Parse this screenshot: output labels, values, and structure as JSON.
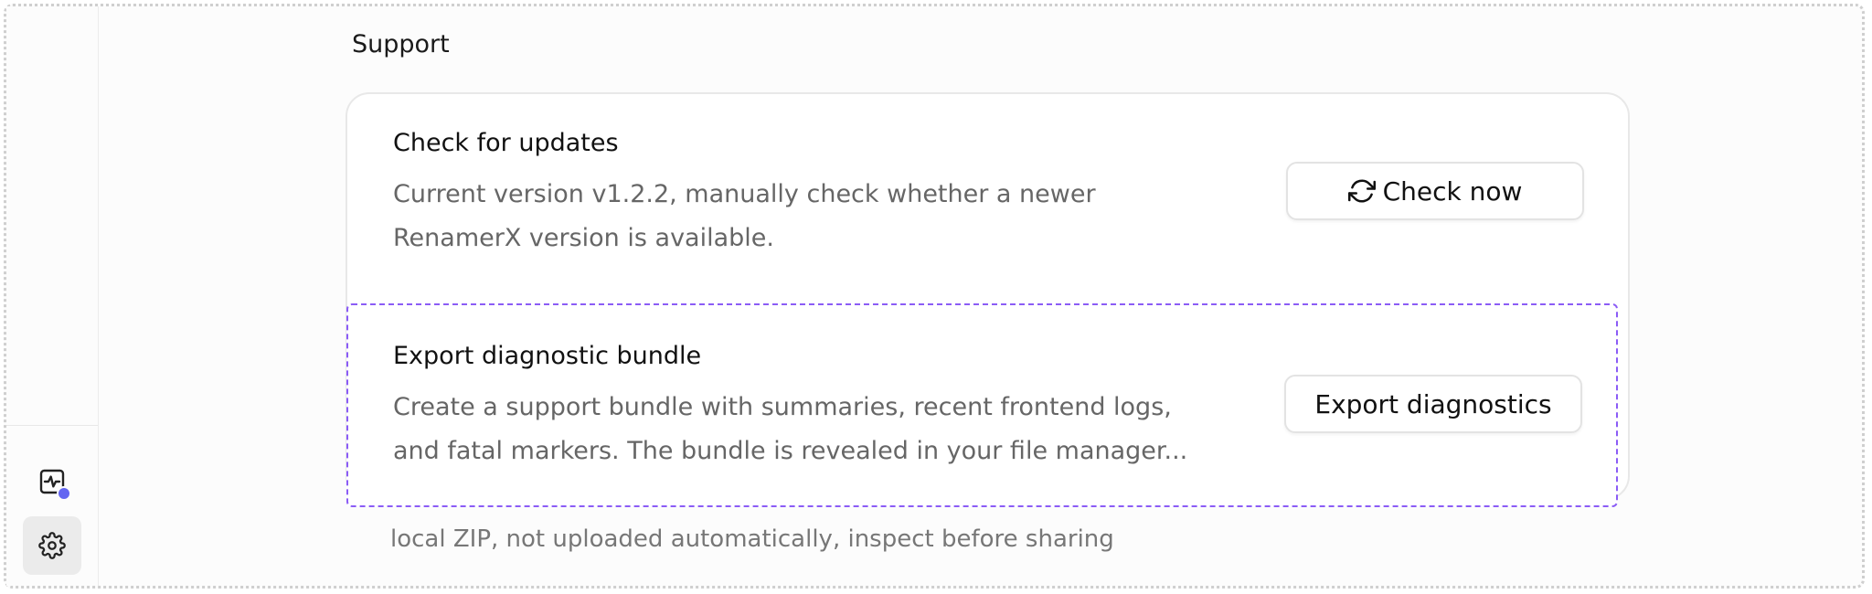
{
  "sidebar": {
    "items": [
      {
        "icon": "activity-monitor-icon",
        "status_color": "#6366f1"
      },
      {
        "icon": "gear-icon",
        "active": true
      }
    ]
  },
  "support": {
    "title": "Support",
    "updates": {
      "title": "Check for updates",
      "description": "Current version v1.2.2, manually check whether a newer RenamerX version is available.",
      "button_label": "Check now",
      "button_icon": "refresh-icon"
    },
    "diagnostics": {
      "title": "Export diagnostic bundle",
      "description": "Create a support bundle with summaries, recent frontend logs, and fatal markers. The bundle is revealed in your file manager...",
      "button_label": "Export diagnostics"
    },
    "footnote": "local ZIP, not uploaded automatically, inspect before sharing"
  },
  "colors": {
    "accent": "#6366f1",
    "highlight_border": "#8b5cf6"
  }
}
